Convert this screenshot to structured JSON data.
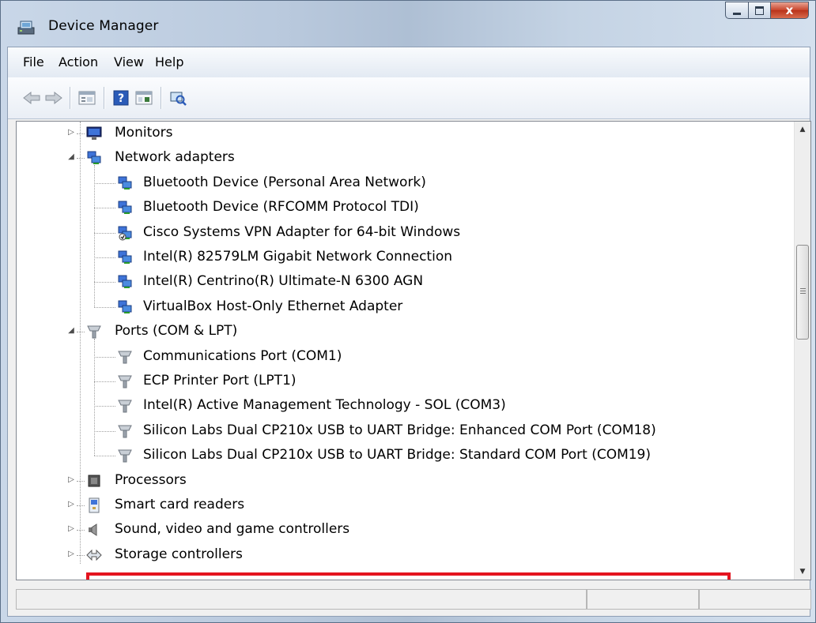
{
  "window": {
    "title": "Device Manager",
    "close_glyph": "x"
  },
  "menu": {
    "items": [
      "File",
      "Action",
      "View",
      "Help"
    ]
  },
  "toolbar": {
    "buttons": [
      "back-arrow-icon",
      "forward-arrow-icon",
      "properties-icon",
      "help-icon",
      "details-icon",
      "scan-hardware-icon"
    ]
  },
  "tree": {
    "nodes": [
      {
        "label": "Monitors",
        "level": 0,
        "expanded": false,
        "icon": "monitor-icon"
      },
      {
        "label": "Network adapters",
        "level": 0,
        "expanded": true,
        "icon": "network-adapter-icon"
      },
      {
        "label": "Bluetooth Device (Personal Area Network)",
        "level": 1,
        "icon": "network-adapter-icon"
      },
      {
        "label": "Bluetooth Device (RFCOMM Protocol TDI)",
        "level": 1,
        "icon": "network-adapter-icon"
      },
      {
        "label": "Cisco Systems VPN Adapter for 64-bit Windows",
        "level": 1,
        "icon": "network-adapter-disabled-icon"
      },
      {
        "label": "Intel(R) 82579LM Gigabit Network Connection",
        "level": 1,
        "icon": "network-adapter-icon"
      },
      {
        "label": "Intel(R) Centrino(R) Ultimate-N 6300 AGN",
        "level": 1,
        "icon": "network-adapter-icon"
      },
      {
        "label": "VirtualBox Host-Only Ethernet Adapter",
        "level": 1,
        "icon": "network-adapter-icon"
      },
      {
        "label": "Ports (COM & LPT)",
        "level": 0,
        "expanded": true,
        "icon": "port-icon"
      },
      {
        "label": "Communications Port (COM1)",
        "level": 1,
        "icon": "port-icon"
      },
      {
        "label": "ECP Printer Port (LPT1)",
        "level": 1,
        "icon": "port-icon"
      },
      {
        "label": "Intel(R) Active Management Technology - SOL (COM3)",
        "level": 1,
        "icon": "port-icon"
      },
      {
        "label": "Silicon Labs Dual CP210x USB to UART Bridge: Enhanced COM Port (COM18)",
        "level": 1,
        "icon": "port-icon"
      },
      {
        "label": "Silicon Labs Dual CP210x USB to UART Bridge: Standard COM Port (COM19)",
        "level": 1,
        "icon": "port-icon",
        "highlighted": true
      },
      {
        "label": "Processors",
        "level": 0,
        "expanded": false,
        "icon": "processor-icon"
      },
      {
        "label": "Smart card readers",
        "level": 0,
        "expanded": false,
        "icon": "smart-card-reader-icon"
      },
      {
        "label": "Sound, video and game controllers",
        "level": 0,
        "expanded": false,
        "icon": "speaker-icon"
      },
      {
        "label": "Storage controllers",
        "level": 0,
        "expanded": false,
        "icon": "storage-controller-icon"
      }
    ]
  },
  "colors": {
    "highlight_border": "#e4141f",
    "window_frame": "#b9c9dd"
  },
  "statusbar": {
    "text": ""
  }
}
